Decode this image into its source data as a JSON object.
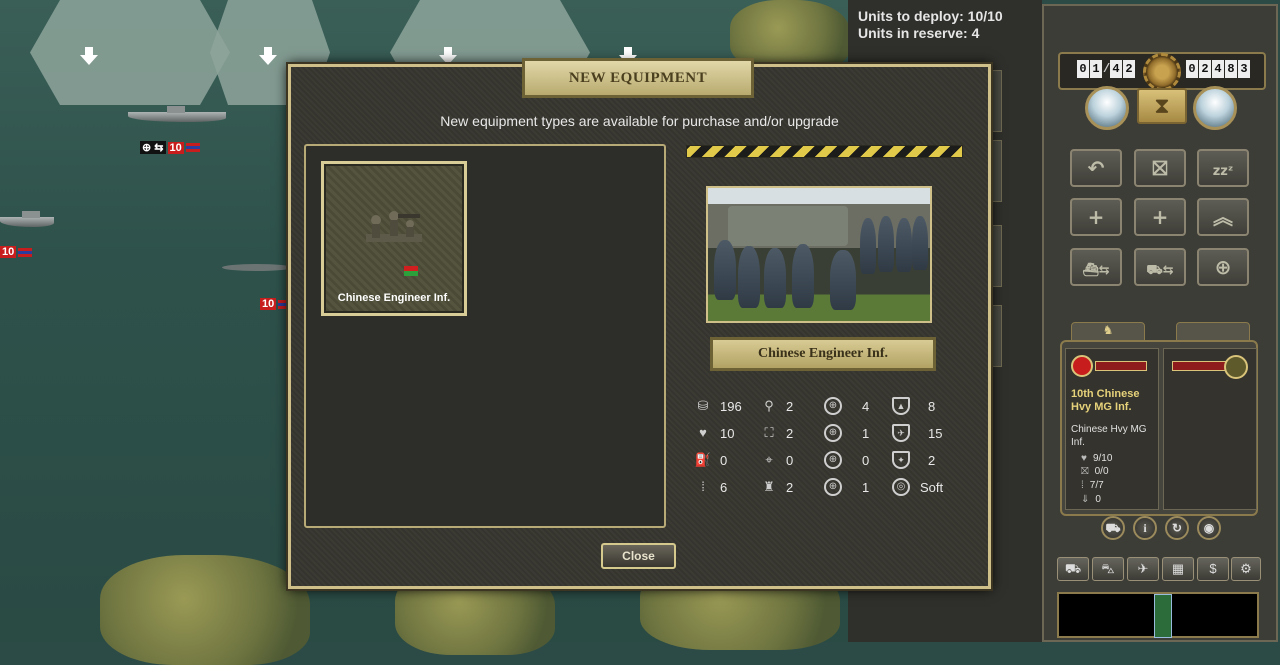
{
  "deploy": {
    "units_to_deploy": "Units to deploy: 10/10",
    "units_in_reserve": "Units in reserve: 4"
  },
  "map_units": [
    {
      "strength": "10"
    },
    {
      "strength": "10"
    },
    {
      "strength": "10"
    }
  ],
  "turn_panel": {
    "turn_digits": [
      "0",
      "1",
      "4",
      "2"
    ],
    "prestige_digits": [
      "0",
      "2",
      "4",
      "8",
      "3"
    ]
  },
  "dialog": {
    "title": "NEW EQUIPMENT",
    "subtitle": "New equipment types are available for purchase and/or upgrade",
    "equipment_item": "Chinese Engineer Inf.",
    "nameplate": "Chinese Engineer Inf.",
    "close_label": "Close"
  },
  "stats": [
    {
      "icon": "cost-icon",
      "glyph": "⛁",
      "value": "196"
    },
    {
      "icon": "movement-icon",
      "glyph": "⚲",
      "value": "2"
    },
    {
      "icon": "soft-attack-icon",
      "glyph": "⊕",
      "value": "4"
    },
    {
      "icon": "ground-defense-icon",
      "glyph": "▲",
      "value": "8"
    },
    {
      "icon": "strength-icon",
      "glyph": "♥",
      "value": "10"
    },
    {
      "icon": "spotting-icon",
      "glyph": "⛶",
      "value": "2"
    },
    {
      "icon": "hard-attack-icon",
      "glyph": "⊕",
      "value": "1"
    },
    {
      "icon": "air-defense-icon",
      "glyph": "✈",
      "value": "15"
    },
    {
      "icon": "fuel-icon",
      "glyph": "⛽",
      "value": "0"
    },
    {
      "icon": "range-icon",
      "glyph": "⌖",
      "value": "0"
    },
    {
      "icon": "air-attack-icon",
      "glyph": "⊕",
      "value": "0"
    },
    {
      "icon": "close-defense-icon",
      "glyph": "✦",
      "value": "2"
    },
    {
      "icon": "ammo-icon",
      "glyph": "⁞",
      "value": "6"
    },
    {
      "icon": "initiative-icon",
      "glyph": "♜",
      "value": "2"
    },
    {
      "icon": "naval-attack-icon",
      "glyph": "⊕",
      "value": "1"
    },
    {
      "icon": "target-type-icon",
      "glyph": "◎",
      "value": "Soft"
    }
  ],
  "unit_card": {
    "name": "10th Chinese Hvy MG Inf.",
    "type": "Chinese Hvy MG Inf.",
    "strength": "9/10",
    "fuel": "0/0",
    "ammo": "7/7",
    "entrenchment": "0"
  },
  "colors": {
    "accent_gold": "#cfc08a",
    "hazard_yellow": "#e1c94a",
    "flag_red": "#c81d1d"
  }
}
